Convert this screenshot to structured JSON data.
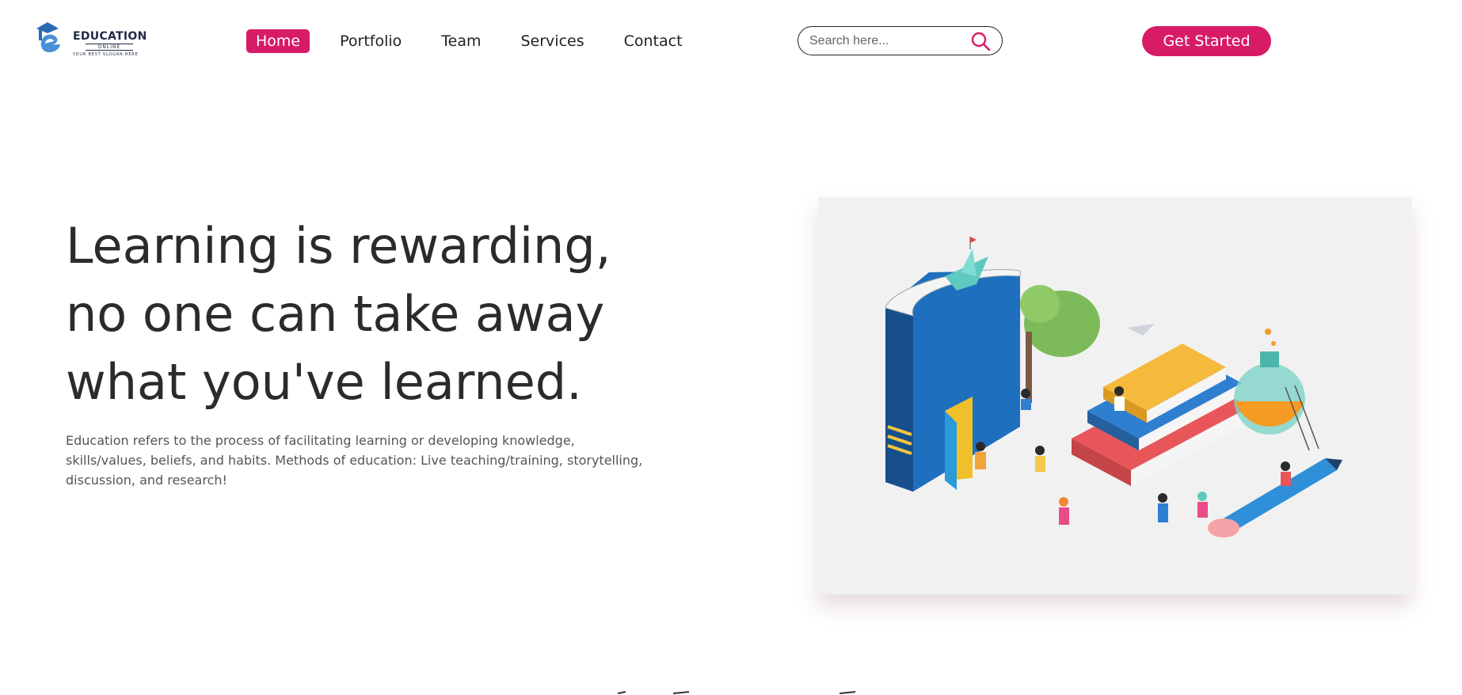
{
  "brand": {
    "title": "EDUCATION",
    "subtitle": "ONLINE",
    "slogan": "YOUR BEST SLOGAN HERE"
  },
  "nav": {
    "items": [
      {
        "label": "Home",
        "active": true
      },
      {
        "label": "Portfolio",
        "active": false
      },
      {
        "label": "Team",
        "active": false
      },
      {
        "label": "Services",
        "active": false
      },
      {
        "label": "Contact",
        "active": false
      }
    ],
    "search_placeholder": "Search here...",
    "cta_label": "Get Started"
  },
  "hero": {
    "title": "Learning is rewarding, no one can take away what you've learned.",
    "description": "Education refers to the process of facilitating learning or developing knowledge, skills/values, beliefs, and habits. Methods of education: Live teaching/training, storytelling, discussion, and research!",
    "illustration": "education-isometric-books-students"
  },
  "colors": {
    "accent": "#d81b66",
    "text_dark": "#2b2b2b",
    "text_body": "#555555",
    "image_bg": "#f1f1f1"
  }
}
